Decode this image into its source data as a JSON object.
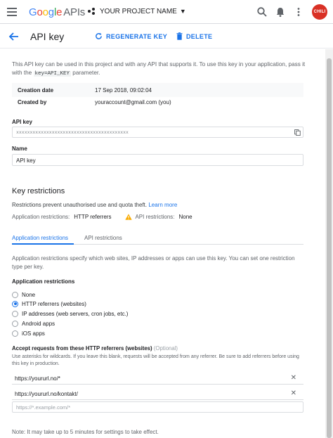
{
  "header": {
    "logo_google": "Google",
    "logo_apis": "APIs",
    "project_name": "YOUR PROJECT NAME",
    "avatar_text": "CHILI"
  },
  "toolbar": {
    "title": "API key",
    "regenerate_label": "REGENERATE KEY",
    "delete_label": "DELETE"
  },
  "intro": {
    "text_before": "This API key can be used in this project and with any API that supports it. To use this key in your application, pass it with the ",
    "code": "key=API_KEY",
    "text_after": " parameter."
  },
  "meta": [
    {
      "label": "Creation date",
      "value": "17 Sep 2018, 09:02:04"
    },
    {
      "label": "Created by",
      "value": "youraccount@gmail.com (you)"
    }
  ],
  "api_key": {
    "label": "API key",
    "value": "xxxxxxxxxxxxxxxxxxxxxxxxxxxxxxxxxxxxxxxxx"
  },
  "name": {
    "label": "Name",
    "value": "API key"
  },
  "restrictions": {
    "title": "Key restrictions",
    "description": "Restrictions prevent unauthorised use and quota theft.",
    "learn_more": "Learn more",
    "app_label": "Application restrictions:",
    "app_value": "HTTP referrers",
    "api_label": "API restrictions:",
    "api_value": "None"
  },
  "tabs": [
    {
      "label": "Application restrictions"
    },
    {
      "label": "API restrictions"
    }
  ],
  "app_restrictions": {
    "description": "Application restrictions specify which web sites, IP addresses or apps can use this key. You can set one restriction type per key.",
    "heading": "Application restrictions",
    "options": [
      {
        "label": "None"
      },
      {
        "label": "HTTP referrers (websites)"
      },
      {
        "label": "IP addresses (web servers, cron jobs, etc.)"
      },
      {
        "label": "Android apps"
      },
      {
        "label": "iOS apps"
      }
    ],
    "selected": "HTTP referrers (websites)"
  },
  "referrers": {
    "label": "Accept requests from these HTTP referrers (websites)",
    "optional": "(Optional)",
    "hint": "Use asterisks for wildcards. If you leave this blank, requests will be accepted from any referrer. Be sure to add referrers before using this key in production.",
    "items": [
      {
        "value": "https://yoururl.no/*"
      },
      {
        "value": "https://yoururl.no/kontakt/"
      }
    ],
    "placeholder": "https://*.example.com/*"
  },
  "note": "Note: It may take up to 5 minutes for settings to take effect.",
  "colors": {
    "accent": "#1a73e8",
    "avatar": "#d93025",
    "warning": "#f9ab00"
  }
}
